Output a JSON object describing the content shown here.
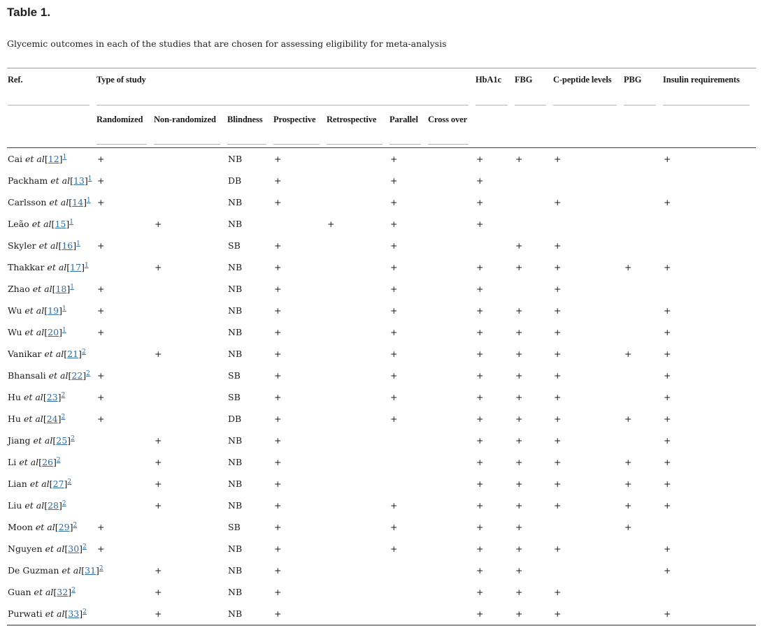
{
  "title": "Table 1.",
  "caption": "Glycemic outcomes in each of the studies that are chosen for assessing eligibility for meta-analysis",
  "strings": {
    "et_al": "et al",
    "bracket_open": "[",
    "bracket_close": "]"
  },
  "colors": {
    "link_blue": "#2e6da4",
    "rule_light": "#b4b4b4",
    "rule_dark": "#3e3e3e"
  },
  "table": {
    "headers": {
      "ref": "Ref.",
      "type_of_study": "Type of study",
      "hba1c": "HbA1c",
      "fbg": "FBG",
      "c_peptide": "C-peptide levels",
      "pbg": "PBG",
      "insulin": "Insulin requirements",
      "sub": {
        "randomized": "Randomized",
        "non_randomized": "Non-randomized",
        "blindness": "Blindness",
        "prospective": "Prospective",
        "retrospective": "Retrospective",
        "parallel": "Parallel",
        "cross_over": "Cross over"
      }
    },
    "rows": [
      {
        "name": "Cai",
        "ref": "12",
        "note": "1",
        "randomized": "+",
        "non_randomized": "",
        "blindness": "NB",
        "prospective": "+",
        "retrospective": "",
        "parallel": "+",
        "cross_over": "",
        "hba1c": "+",
        "fbg": "+",
        "c_peptide": "+",
        "pbg": "",
        "insulin": "+"
      },
      {
        "name": "Packham",
        "ref": "13",
        "note": "1",
        "randomized": "+",
        "non_randomized": "",
        "blindness": "DB",
        "prospective": "+",
        "retrospective": "",
        "parallel": "+",
        "cross_over": "",
        "hba1c": "+",
        "fbg": "",
        "c_peptide": "",
        "pbg": "",
        "insulin": ""
      },
      {
        "name": "Carlsson",
        "ref": "14",
        "note": "1",
        "randomized": "+",
        "non_randomized": "",
        "blindness": "NB",
        "prospective": "+",
        "retrospective": "",
        "parallel": "+",
        "cross_over": "",
        "hba1c": "+",
        "fbg": "",
        "c_peptide": "+",
        "pbg": "",
        "insulin": "+"
      },
      {
        "name": "Leão",
        "ref": "15",
        "note": "1",
        "randomized": "",
        "non_randomized": "+",
        "blindness": "NB",
        "prospective": "",
        "retrospective": "+",
        "parallel": "+",
        "cross_over": "",
        "hba1c": "+",
        "fbg": "",
        "c_peptide": "",
        "pbg": "",
        "insulin": ""
      },
      {
        "name": "Skyler",
        "ref": "16",
        "note": "1",
        "randomized": "+",
        "non_randomized": "",
        "blindness": "SB",
        "prospective": "+",
        "retrospective": "",
        "parallel": "+",
        "cross_over": "",
        "hba1c": "",
        "fbg": "+",
        "c_peptide": "+",
        "pbg": "",
        "insulin": ""
      },
      {
        "name": "Thakkar",
        "ref": "17",
        "note": "1",
        "randomized": "",
        "non_randomized": "+",
        "blindness": "NB",
        "prospective": "+",
        "retrospective": "",
        "parallel": "+",
        "cross_over": "",
        "hba1c": "+",
        "fbg": "+",
        "c_peptide": "+",
        "pbg": "+",
        "insulin": "+"
      },
      {
        "name": "Zhao",
        "ref": "18",
        "note": "1",
        "randomized": "+",
        "non_randomized": "",
        "blindness": "NB",
        "prospective": "+",
        "retrospective": "",
        "parallel": "+",
        "cross_over": "",
        "hba1c": "+",
        "fbg": "",
        "c_peptide": "+",
        "pbg": "",
        "insulin": ""
      },
      {
        "name": "Wu",
        "ref": "19",
        "note": "1",
        "randomized": "+",
        "non_randomized": "",
        "blindness": "NB",
        "prospective": "+",
        "retrospective": "",
        "parallel": "+",
        "cross_over": "",
        "hba1c": "+",
        "fbg": "+",
        "c_peptide": "+",
        "pbg": "",
        "insulin": "+"
      },
      {
        "name": "Wu",
        "ref": "20",
        "note": "1",
        "randomized": "+",
        "non_randomized": "",
        "blindness": "NB",
        "prospective": "+",
        "retrospective": "",
        "parallel": "+",
        "cross_over": "",
        "hba1c": "+",
        "fbg": "+",
        "c_peptide": "+",
        "pbg": "",
        "insulin": "+"
      },
      {
        "name": "Vanikar",
        "ref": "21",
        "note": "2",
        "randomized": "",
        "non_randomized": "+",
        "blindness": "NB",
        "prospective": "+",
        "retrospective": "",
        "parallel": "+",
        "cross_over": "",
        "hba1c": "+",
        "fbg": "+",
        "c_peptide": "+",
        "pbg": "+",
        "insulin": "+"
      },
      {
        "name": "Bhansali",
        "ref": "22",
        "note": "2",
        "randomized": "+",
        "non_randomized": "",
        "blindness": "SB",
        "prospective": "+",
        "retrospective": "",
        "parallel": "+",
        "cross_over": "",
        "hba1c": "+",
        "fbg": "+",
        "c_peptide": "+",
        "pbg": "",
        "insulin": "+"
      },
      {
        "name": "Hu",
        "ref": "23",
        "note": "2",
        "randomized": "+",
        "non_randomized": "",
        "blindness": "SB",
        "prospective": "+",
        "retrospective": "",
        "parallel": "+",
        "cross_over": "",
        "hba1c": "+",
        "fbg": "+",
        "c_peptide": "+",
        "pbg": "",
        "insulin": "+"
      },
      {
        "name": "Hu",
        "ref": "24",
        "note": "2",
        "randomized": "+",
        "non_randomized": "",
        "blindness": "DB",
        "prospective": "+",
        "retrospective": "",
        "parallel": "+",
        "cross_over": "",
        "hba1c": "+",
        "fbg": "+",
        "c_peptide": "+",
        "pbg": "+",
        "insulin": "+"
      },
      {
        "name": "Jiang",
        "ref": "25",
        "note": "2",
        "randomized": "",
        "non_randomized": "+",
        "blindness": "NB",
        "prospective": "+",
        "retrospective": "",
        "parallel": "",
        "cross_over": "",
        "hba1c": "+",
        "fbg": "+",
        "c_peptide": "+",
        "pbg": "",
        "insulin": "+"
      },
      {
        "name": "Li",
        "ref": "26",
        "note": "2",
        "randomized": "",
        "non_randomized": "+",
        "blindness": "NB",
        "prospective": "+",
        "retrospective": "",
        "parallel": "",
        "cross_over": "",
        "hba1c": "+",
        "fbg": "+",
        "c_peptide": "+",
        "pbg": "+",
        "insulin": "+"
      },
      {
        "name": "Lian",
        "ref": "27",
        "note": "2",
        "randomized": "",
        "non_randomized": "+",
        "blindness": "NB",
        "prospective": "+",
        "retrospective": "",
        "parallel": "",
        "cross_over": "",
        "hba1c": "+",
        "fbg": "+",
        "c_peptide": "+",
        "pbg": "+",
        "insulin": "+"
      },
      {
        "name": "Liu",
        "ref": "28",
        "note": "2",
        "randomized": "",
        "non_randomized": "+",
        "blindness": "NB",
        "prospective": "+",
        "retrospective": "",
        "parallel": "+",
        "cross_over": "",
        "hba1c": "+",
        "fbg": "+",
        "c_peptide": "+",
        "pbg": "+",
        "insulin": "+"
      },
      {
        "name": "Moon",
        "ref": "29",
        "note": "2",
        "randomized": "+",
        "non_randomized": "",
        "blindness": "SB",
        "prospective": "+",
        "retrospective": "",
        "parallel": "+",
        "cross_over": "",
        "hba1c": "+",
        "fbg": "+",
        "c_peptide": "",
        "pbg": "+",
        "insulin": ""
      },
      {
        "name": "Nguyen",
        "ref": "30",
        "note": "2",
        "randomized": "+",
        "non_randomized": "",
        "blindness": "NB",
        "prospective": "+",
        "retrospective": "",
        "parallel": "+",
        "cross_over": "",
        "hba1c": "+",
        "fbg": "+",
        "c_peptide": "+",
        "pbg": "",
        "insulin": "+"
      },
      {
        "name": "De Guzman",
        "ref": "31",
        "note": "2",
        "randomized": "",
        "non_randomized": "+",
        "blindness": "NB",
        "prospective": "+",
        "retrospective": "",
        "parallel": "",
        "cross_over": "",
        "hba1c": "+",
        "fbg": "+",
        "c_peptide": "",
        "pbg": "",
        "insulin": "+"
      },
      {
        "name": "Guan",
        "ref": "32",
        "note": "2",
        "randomized": "",
        "non_randomized": "+",
        "blindness": "NB",
        "prospective": "+",
        "retrospective": "",
        "parallel": "",
        "cross_over": "",
        "hba1c": "+",
        "fbg": "+",
        "c_peptide": "+",
        "pbg": "",
        "insulin": ""
      },
      {
        "name": "Purwati",
        "ref": "33",
        "note": "2",
        "randomized": "",
        "non_randomized": "+",
        "blindness": "NB",
        "prospective": "+",
        "retrospective": "",
        "parallel": "",
        "cross_over": "",
        "hba1c": "+",
        "fbg": "+",
        "c_peptide": "+",
        "pbg": "",
        "insulin": "+"
      }
    ]
  }
}
